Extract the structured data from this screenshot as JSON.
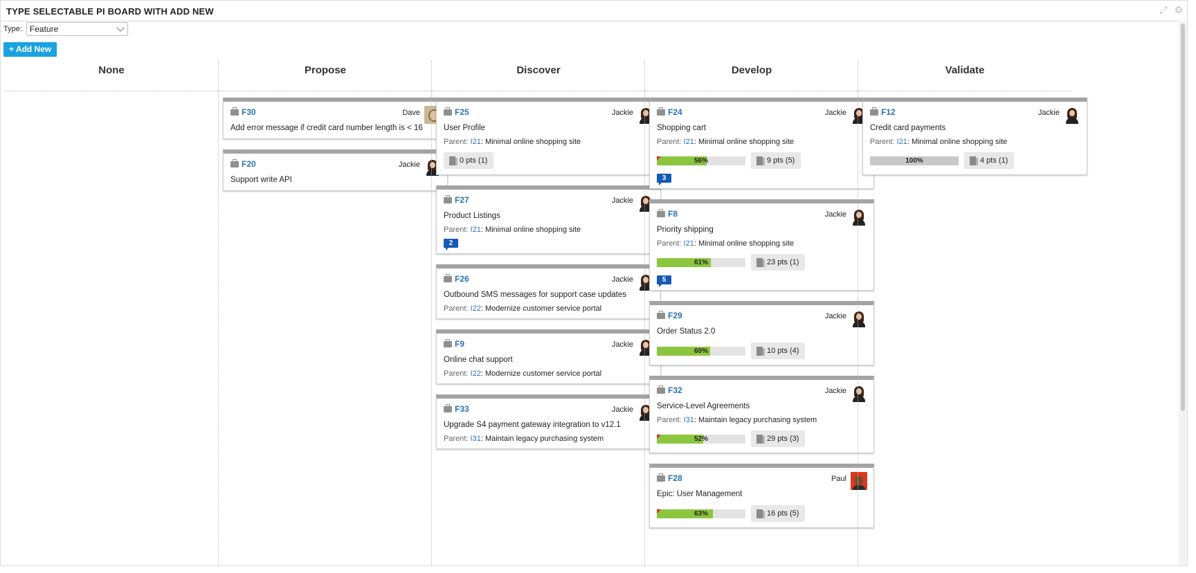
{
  "window": {
    "title": "TYPE SELECTABLE PI BOARD WITH ADD NEW",
    "icons": [
      "expand-icon",
      "gear-icon"
    ]
  },
  "filter": {
    "label": "Type:",
    "value": "Feature"
  },
  "add_button": "+ Add New",
  "columns": [
    {
      "name": "None",
      "cards": []
    },
    {
      "name": "Propose",
      "cards": [
        {
          "id": "F30",
          "owner": "Dave",
          "avatar": "dave",
          "title": "Add error message if credit card number length is < 16"
        },
        {
          "id": "F20",
          "owner": "Jackie",
          "avatar": "jackie",
          "title": "Support write API"
        }
      ]
    },
    {
      "name": "Discover",
      "cards": [
        {
          "id": "F25",
          "owner": "Jackie",
          "avatar": "jackie",
          "title": "User Profile",
          "parent_label": "Parent:",
          "parent_id": "I21",
          "parent_name": ": Minimal online shopping site",
          "pts": "0 pts (1)"
        },
        {
          "id": "F27",
          "owner": "Jackie",
          "avatar": "jackie",
          "title": "Product Listings",
          "parent_label": "Parent:",
          "parent_id": "I21",
          "parent_name": ": Minimal online shopping site",
          "comments": "2"
        },
        {
          "id": "F26",
          "owner": "Jackie",
          "avatar": "jackie",
          "title": "Outbound SMS messages for support case updates",
          "parent_label": "Parent:",
          "parent_id": "I22",
          "parent_name": ": Modernize customer service portal"
        },
        {
          "id": "F9",
          "owner": "Jackie",
          "avatar": "jackie",
          "title": "Online chat support",
          "parent_label": "Parent:",
          "parent_id": "I22",
          "parent_name": ": Modernize customer service portal"
        },
        {
          "id": "F33",
          "owner": "Jackie",
          "avatar": "jackie",
          "title": "Upgrade S4 payment gateway integration to v12.1",
          "parent_label": "Parent:",
          "parent_id": "I31",
          "parent_name": ": Maintain legacy purchasing system"
        }
      ]
    },
    {
      "name": "Develop",
      "cards": [
        {
          "id": "F24",
          "owner": "Jackie",
          "avatar": "jackie",
          "title": "Shopping cart",
          "parent_label": "Parent:",
          "parent_id": "I21",
          "parent_name": ": Minimal online shopping site",
          "progress": 56,
          "progress_label": "56%",
          "flag": true,
          "pts": "9 pts (5)",
          "comments": "3"
        },
        {
          "id": "F8",
          "owner": "Jackie",
          "avatar": "jackie",
          "title": "Priority shipping",
          "parent_label": "Parent:",
          "parent_id": "I21",
          "parent_name": ": Minimal online shopping site",
          "progress": 61,
          "progress_label": "61%",
          "pts": "23 pts (1)",
          "comments": "5"
        },
        {
          "id": "F29",
          "owner": "Jackie",
          "avatar": "jackie",
          "title": "Order Status 2.0",
          "progress": 60,
          "progress_label": "60%",
          "pts": "10 pts (4)"
        },
        {
          "id": "F32",
          "owner": "Jackie",
          "avatar": "jackie",
          "title": "Service-Level Agreements",
          "parent_label": "Parent:",
          "parent_id": "I31",
          "parent_name": ": Maintain legacy purchasing system",
          "progress": 52,
          "progress_label": "52%",
          "flag": true,
          "pts": "29 pts (3)"
        },
        {
          "id": "F28",
          "owner": "Paul",
          "avatar": "paul",
          "title": "Epic: User Management",
          "progress": 63,
          "progress_label": "63%",
          "flag": true,
          "pts": "16 pts (5)"
        }
      ]
    },
    {
      "name": "Validate",
      "cards": [
        {
          "id": "F12",
          "owner": "Jackie",
          "avatar": "jackie",
          "title": "Credit card payments",
          "parent_label": "Parent:",
          "parent_id": "I21",
          "parent_name": ": Minimal online shopping site",
          "progress": 100,
          "progress_label": "100%",
          "pts": "4 pts (1)"
        }
      ]
    }
  ]
}
